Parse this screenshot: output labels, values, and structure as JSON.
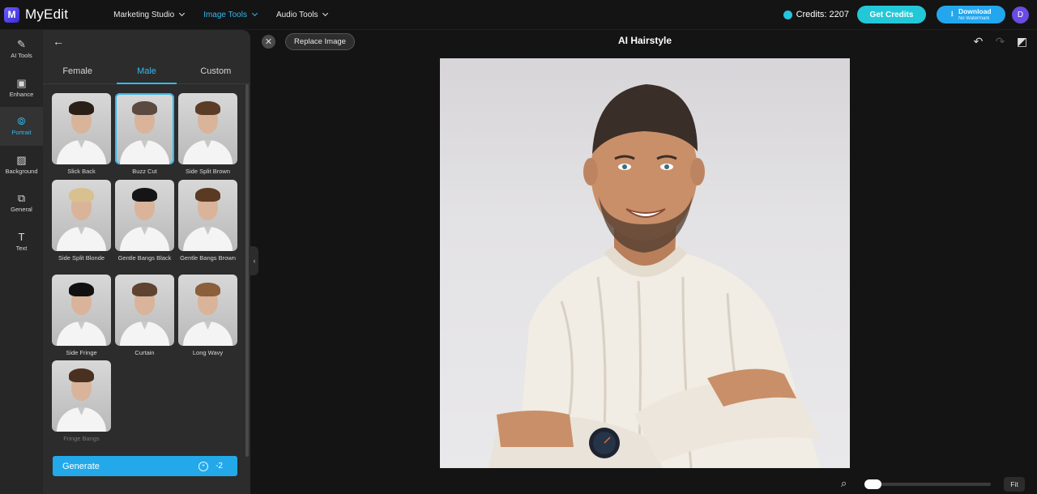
{
  "app": {
    "logo_letter": "M",
    "name": "MyEdit"
  },
  "topnav": [
    {
      "label": "Marketing Studio",
      "active": false
    },
    {
      "label": "Image Tools",
      "active": true
    },
    {
      "label": "Audio Tools",
      "active": false
    }
  ],
  "header": {
    "credits_label": "Credits: 2207",
    "get_credits_label": "Get Credits",
    "download_label": "Download",
    "download_sub": "No Watermark",
    "avatar_initial": "D"
  },
  "rail": [
    {
      "label": "AI Tools",
      "icon": "wand-icon",
      "glyph": "✎",
      "active": false
    },
    {
      "label": "Enhance",
      "icon": "enhance-icon",
      "glyph": "▣",
      "active": false
    },
    {
      "label": "Portrait",
      "icon": "portrait-icon",
      "glyph": "⦾",
      "active": true
    },
    {
      "label": "Background",
      "icon": "background-icon",
      "glyph": "▨",
      "active": false
    },
    {
      "label": "General",
      "icon": "general-icon",
      "glyph": "⧉",
      "active": false
    },
    {
      "label": "Text",
      "icon": "text-icon",
      "glyph": "T",
      "active": false
    }
  ],
  "panel": {
    "tabs": [
      {
        "label": "Female",
        "active": false
      },
      {
        "label": "Male",
        "active": true
      },
      {
        "label": "Custom",
        "active": false
      }
    ],
    "styles": [
      {
        "label": "Slick Back",
        "hair": "#2b2018",
        "selected": false,
        "dim": false
      },
      {
        "label": "Buzz Cut",
        "hair": "#5a4a40",
        "selected": true,
        "dim": false
      },
      {
        "label": "Side Split Brown",
        "hair": "#5b3d27",
        "selected": false,
        "dim": false
      },
      {
        "label": "Side Split Blonde",
        "hair": "#d9c18f",
        "selected": false,
        "dim": false
      },
      {
        "label": "Gentle Bangs Black",
        "hair": "#151515",
        "selected": false,
        "dim": false
      },
      {
        "label": "Gentle Bangs Brown",
        "hair": "#5a3a22",
        "selected": false,
        "dim": false
      },
      {
        "label": "Side Fringe",
        "hair": "#111111",
        "selected": false,
        "dim": false
      },
      {
        "label": "Curtain",
        "hair": "#5e4330",
        "selected": false,
        "dim": false
      },
      {
        "label": "Long Wavy",
        "hair": "#8a5f3a",
        "selected": false,
        "dim": false
      },
      {
        "label": "Fringe Bangs",
        "hair": "#4a3020",
        "selected": false,
        "dim": true
      }
    ],
    "generate_label": "Generate",
    "generate_cost": "-2"
  },
  "editor": {
    "replace_label": "Replace Image",
    "title": "AI Hairstyle",
    "fit_label": "Fit",
    "zoom_level": 0
  },
  "colors": {
    "accent": "#35b8f0",
    "get_credits": "#23c8d8",
    "download": "#22a7ee",
    "avatar": "#6a4be3",
    "sweater": "#f1ece4",
    "skin": "#c98f69"
  }
}
